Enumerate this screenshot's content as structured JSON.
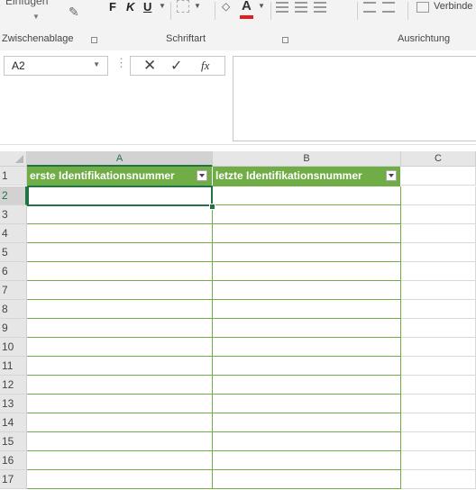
{
  "ribbon": {
    "paste_label": "Einfügen",
    "bold": "F",
    "italic": "K",
    "underline": "U",
    "fontcolor_letter": "A",
    "merge_label": "Verbinde",
    "groups": {
      "clipboard": "Zwischenablage",
      "font": "Schriftart",
      "alignment": "Ausrichtung"
    },
    "icons": {
      "brush": "format-painter-icon",
      "border": "border-icon",
      "fill": "fill-color-icon",
      "fontcolor": "font-color-icon"
    }
  },
  "formula_bar": {
    "name_box": "A2",
    "value": "",
    "fx": "fx"
  },
  "sheet": {
    "columns": [
      "A",
      "B",
      "C"
    ],
    "selected_column": "A",
    "rows": [
      "1",
      "2",
      "3",
      "4",
      "5",
      "6",
      "7",
      "8",
      "9",
      "10",
      "11",
      "12",
      "13",
      "14",
      "15",
      "16",
      "17"
    ],
    "selected_row": "2",
    "table_headers": [
      "erste Identifikationsnummer",
      "letzte Identifikationsnummer"
    ],
    "accent_color": "#217346",
    "table_color": "#70ad47"
  }
}
